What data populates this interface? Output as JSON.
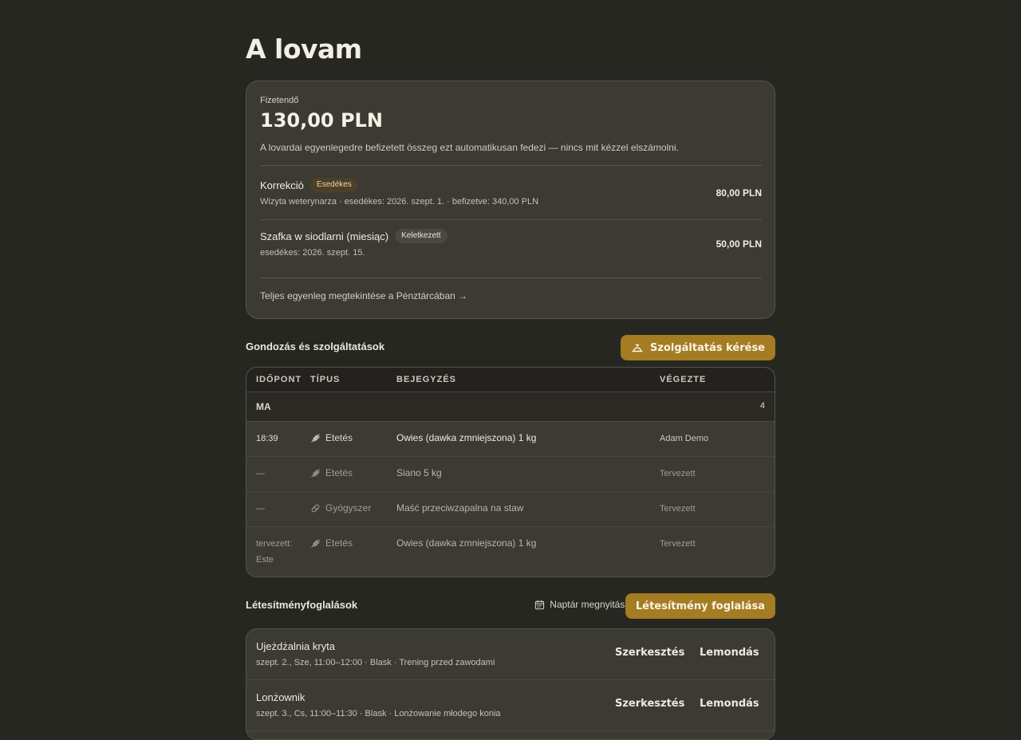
{
  "page": {
    "title": "A lovam"
  },
  "payment": {
    "label": "Fizetendő",
    "amount": "130,00 PLN",
    "note": "A lovardai egyenlegedre befizetett összeg ezt automatikusan fedezi — nincs mit kézzel elszámolni.",
    "charges": [
      {
        "title": "Korrekció",
        "badge": "Esedékes",
        "sub": "Wizyta weterynarza · esedékes: 2026. szept. 1. · befizetve: 340,00 PLN",
        "amount": "80,00 PLN"
      },
      {
        "title": "Szafka w siodlarni (miesiąc)",
        "badge": "Keletkezett",
        "sub": "esedékes: 2026. szept. 15.",
        "amount": "50,00 PLN"
      }
    ],
    "wallet_link": "Teljes egyenleg megtekintése a Pénztárcában →"
  },
  "care": {
    "title": "Gondozás és szolgáltatások",
    "request_button": "Szolgáltatás kérése",
    "columns": {
      "time": "IDŐPONT",
      "type": "TÍPUS",
      "entry": "BEJEGYZÉS",
      "by": "VÉGEZTE"
    },
    "group": {
      "label": "MA",
      "count": "4"
    },
    "rows": [
      {
        "time": "18:39",
        "type": "Etetés",
        "icon": "wheat-icon",
        "entry": "Owies (dawka zmniejszona) 1 kg",
        "by": "Adam Demo"
      },
      {
        "time": "—",
        "type": "Etetés",
        "icon": "wheat-icon",
        "entry": "Siano 5 kg",
        "by": "Tervezett"
      },
      {
        "time": "—",
        "type": "Gyógyszer",
        "icon": "pill-icon",
        "entry": "Maść przeciwzapalna na staw",
        "by": "Tervezett"
      },
      {
        "time_line1": "tervezett:",
        "time_line2": "Este",
        "type": "Etetés",
        "icon": "wheat-icon",
        "entry": "Owies (dawka zmniejszona) 1 kg",
        "by": "Tervezett"
      }
    ]
  },
  "bookings": {
    "title": "Létesítményfoglalások",
    "calendar_link": "Naptár megnyitása",
    "book_button": "Létesítmény foglalása",
    "items": [
      {
        "title": "Ujeżdżalnia kryta",
        "sub": "szept. 2., Sze, 11:00–12:00 · Blask · Trening przed zawodami",
        "edit": "Szerkesztés",
        "cancel": "Lemondás"
      },
      {
        "title": "Lonżownik",
        "sub": "szept. 3., Cs, 11:00–11:30 · Blask · Lonżowanie młodego konia",
        "edit": "Szerkesztés",
        "cancel": "Lemondás"
      }
    ]
  },
  "colors": {
    "background": "#272722",
    "card": "#3b3a33",
    "accent": "#a47c22",
    "due_badge": "#4d3f27"
  }
}
